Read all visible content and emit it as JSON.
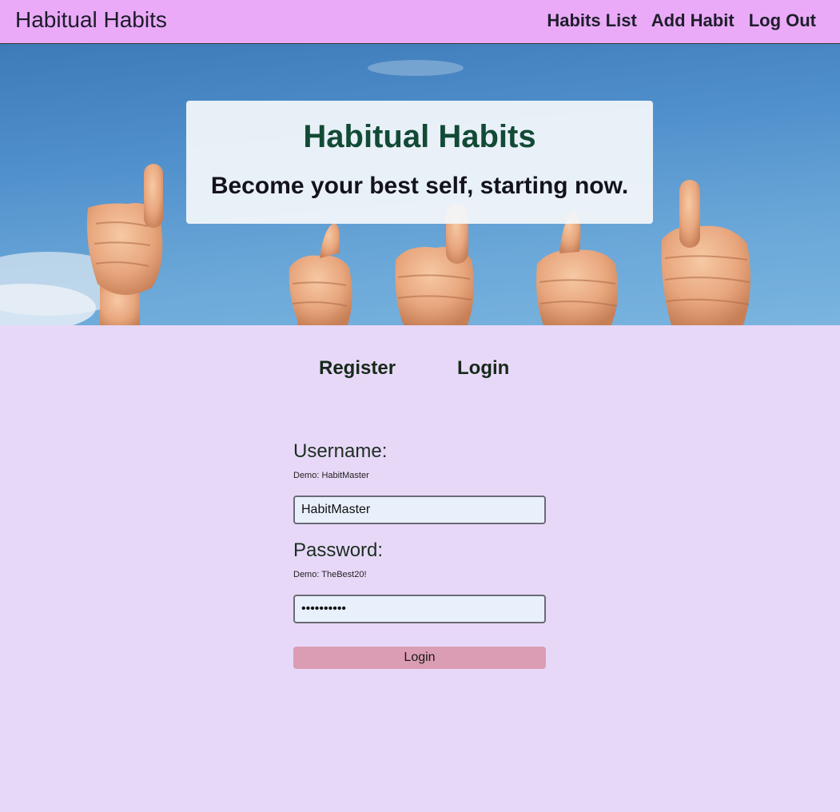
{
  "navbar": {
    "brand": "Habitual Habits",
    "links": [
      "Habits List",
      "Add Habit",
      "Log Out"
    ]
  },
  "hero": {
    "title": "Habitual Habits",
    "subtitle": "Become your best self, starting now."
  },
  "tabs": {
    "register": "Register",
    "login": "Login"
  },
  "form": {
    "username_label": "Username:",
    "username_hint": "Demo: HabitMaster",
    "username_value": "HabitMaster",
    "password_label": "Password:",
    "password_hint": "Demo: TheBest20!",
    "password_value": "TheBest20!",
    "submit_label": "Login"
  },
  "colors": {
    "navbar_bg": "#eaaaf7",
    "page_bg": "#e8d8f8",
    "hero_title": "#124a35",
    "button_bg": "#db9db3"
  }
}
